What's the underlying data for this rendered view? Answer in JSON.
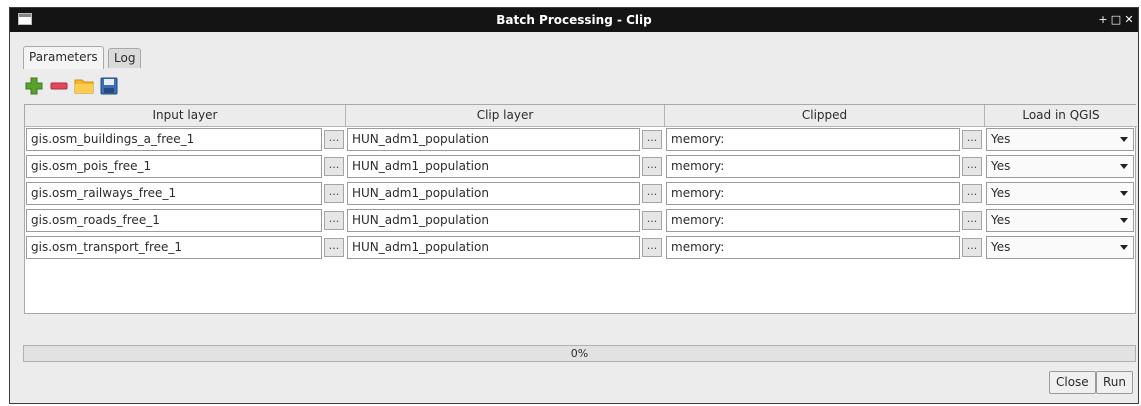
{
  "window": {
    "title": "Batch Processing - Clip",
    "controls": [
      "+",
      "□",
      "✕"
    ]
  },
  "tabs": [
    {
      "label": "Parameters",
      "active": true
    },
    {
      "label": "Log",
      "active": false
    }
  ],
  "toolbar": {
    "icons": [
      "add-row-icon",
      "remove-row-icon",
      "open-folder-icon",
      "save-icon"
    ]
  },
  "table": {
    "columns": [
      "Input layer",
      "Clip layer",
      "Clipped",
      "Load in QGIS"
    ],
    "browse_label": "...",
    "rows": [
      {
        "input": "gis.osm_buildings_a_free_1",
        "clip": "HUN_adm1_population",
        "clipped": "memory:",
        "load": "Yes"
      },
      {
        "input": "gis.osm_pois_free_1",
        "clip": "HUN_adm1_population",
        "clipped": "memory:",
        "load": "Yes"
      },
      {
        "input": "gis.osm_railways_free_1",
        "clip": "HUN_adm1_population",
        "clipped": "memory:",
        "load": "Yes"
      },
      {
        "input": "gis.osm_roads_free_1",
        "clip": "HUN_adm1_population",
        "clipped": "memory:",
        "load": "Yes"
      },
      {
        "input": "gis.osm_transport_free_1",
        "clip": "HUN_adm1_population",
        "clipped": "memory:",
        "load": "Yes"
      }
    ]
  },
  "progress": {
    "text": "0%",
    "value": 0
  },
  "buttons": {
    "close": "Close",
    "run": "Run"
  },
  "colors": {
    "titlebar": "#141414",
    "add": "#5aa02c",
    "remove": "#e04a5a",
    "folder": "#f5b72d",
    "save": "#3b6fb6"
  }
}
